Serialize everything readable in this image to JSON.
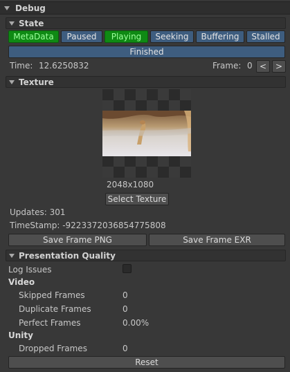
{
  "debug": {
    "title": "Debug"
  },
  "state": {
    "title": "State",
    "buttons": [
      {
        "label": "MetaData",
        "active": true
      },
      {
        "label": "Paused",
        "active": false
      },
      {
        "label": "Playing",
        "active": true
      },
      {
        "label": "Seeking",
        "active": false
      },
      {
        "label": "Buffering",
        "active": false
      },
      {
        "label": "Stalled",
        "active": false
      }
    ],
    "finished_label": "Finished",
    "time_label": "Time:",
    "time_value": "12.6250832",
    "frame_label": "Frame:",
    "frame_value": "0",
    "prev_label": "<",
    "next_label": ">"
  },
  "texture": {
    "title": "Texture",
    "resolution": "2048x1080",
    "select_label": "Select Texture",
    "updates": "Updates: 301",
    "timestamp": "TimeStamp: -9223372036854775808",
    "save_png": "Save Frame PNG",
    "save_exr": "Save Frame EXR"
  },
  "quality": {
    "title": "Presentation Quality",
    "log_issues": "Log Issues",
    "video_heading": "Video",
    "skipped_label": "Skipped Frames",
    "skipped_value": "0",
    "duplicate_label": "Duplicate Frames",
    "duplicate_value": "0",
    "perfect_label": "Perfect Frames",
    "perfect_value": "0.00%",
    "unity_heading": "Unity",
    "dropped_label": "Dropped Frames",
    "dropped_value": "0",
    "reset_label": "Reset"
  },
  "colors": {
    "active_green": "#0f8a14",
    "state_blue": "#3e5d7f",
    "background": "#383838"
  }
}
